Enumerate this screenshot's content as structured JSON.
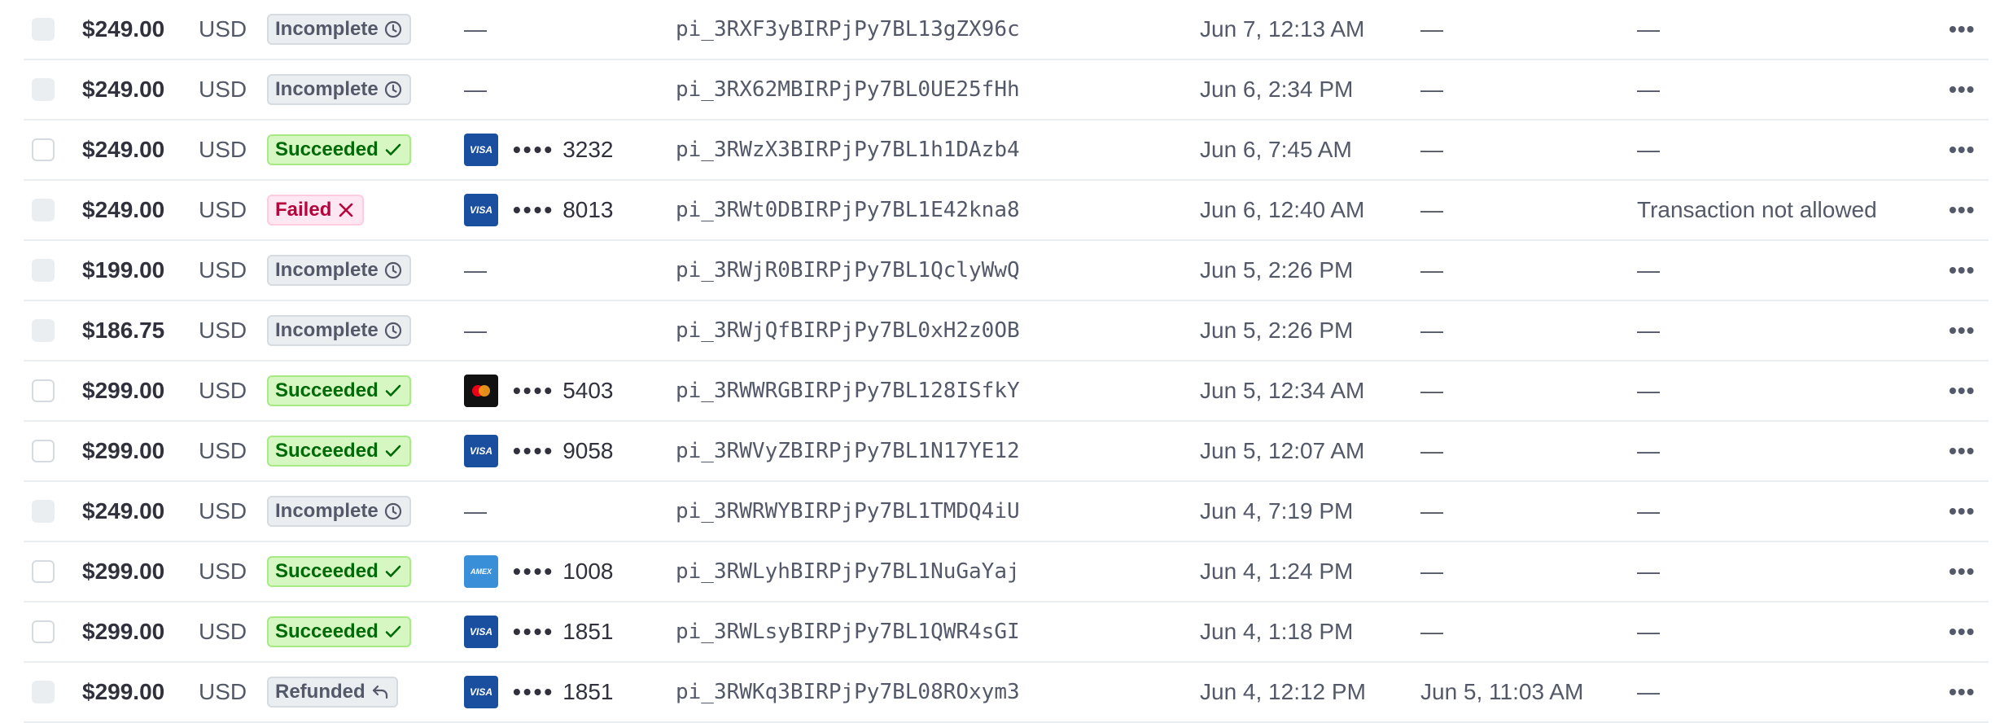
{
  "rows": [
    {
      "amount": "$249.00",
      "currency": "USD",
      "status": "Incomplete",
      "status_kind": "incomplete",
      "card_brand": null,
      "dots": "",
      "last4": "",
      "payment_empty": "—",
      "pi": "pi_3RXF3yBIRPjPy7BL13gZX96c",
      "created": "Jun 7, 12:13 AM",
      "refunded": "—",
      "decline": "—",
      "checkbox_enabled": false
    },
    {
      "amount": "$249.00",
      "currency": "USD",
      "status": "Incomplete",
      "status_kind": "incomplete",
      "card_brand": null,
      "dots": "",
      "last4": "",
      "payment_empty": "—",
      "pi": "pi_3RX62MBIRPjPy7BL0UE25fHh",
      "created": "Jun 6, 2:34 PM",
      "refunded": "—",
      "decline": "—",
      "checkbox_enabled": false
    },
    {
      "amount": "$249.00",
      "currency": "USD",
      "status": "Succeeded",
      "status_kind": "succeeded",
      "card_brand": "visa",
      "dots": "••••",
      "last4": "3232",
      "payment_empty": "",
      "pi": "pi_3RWzX3BIRPjPy7BL1h1DAzb4",
      "created": "Jun 6, 7:45 AM",
      "refunded": "—",
      "decline": "—",
      "checkbox_enabled": true
    },
    {
      "amount": "$249.00",
      "currency": "USD",
      "status": "Failed",
      "status_kind": "failed",
      "card_brand": "visa",
      "dots": "••••",
      "last4": "8013",
      "payment_empty": "",
      "pi": "pi_3RWt0DBIRPjPy7BL1E42kna8",
      "created": "Jun 6, 12:40 AM",
      "refunded": "—",
      "decline": "Transaction not allowed",
      "checkbox_enabled": false
    },
    {
      "amount": "$199.00",
      "currency": "USD",
      "status": "Incomplete",
      "status_kind": "incomplete",
      "card_brand": null,
      "dots": "",
      "last4": "",
      "payment_empty": "—",
      "pi": "pi_3RWjR0BIRPjPy7BL1QclyWwQ",
      "created": "Jun 5, 2:26 PM",
      "refunded": "—",
      "decline": "—",
      "checkbox_enabled": false
    },
    {
      "amount": "$186.75",
      "currency": "USD",
      "status": "Incomplete",
      "status_kind": "incomplete",
      "card_brand": null,
      "dots": "",
      "last4": "",
      "payment_empty": "—",
      "pi": "pi_3RWjQfBIRPjPy7BL0xH2z0OB",
      "created": "Jun 5, 2:26 PM",
      "refunded": "—",
      "decline": "—",
      "checkbox_enabled": false
    },
    {
      "amount": "$299.00",
      "currency": "USD",
      "status": "Succeeded",
      "status_kind": "succeeded",
      "card_brand": "mastercard",
      "dots": "••••",
      "last4": "5403",
      "payment_empty": "",
      "pi": "pi_3RWWRGBIRPjPy7BL128ISfkY",
      "created": "Jun 5, 12:34 AM",
      "refunded": "—",
      "decline": "—",
      "checkbox_enabled": true
    },
    {
      "amount": "$299.00",
      "currency": "USD",
      "status": "Succeeded",
      "status_kind": "succeeded",
      "card_brand": "visa",
      "dots": "••••",
      "last4": "9058",
      "payment_empty": "",
      "pi": "pi_3RWVyZBIRPjPy7BL1N17YE12",
      "created": "Jun 5, 12:07 AM",
      "refunded": "—",
      "decline": "—",
      "checkbox_enabled": true
    },
    {
      "amount": "$249.00",
      "currency": "USD",
      "status": "Incomplete",
      "status_kind": "incomplete",
      "card_brand": null,
      "dots": "",
      "last4": "",
      "payment_empty": "—",
      "pi": "pi_3RWRWYBIRPjPy7BL1TMDQ4iU",
      "created": "Jun 4, 7:19 PM",
      "refunded": "—",
      "decline": "—",
      "checkbox_enabled": false
    },
    {
      "amount": "$299.00",
      "currency": "USD",
      "status": "Succeeded",
      "status_kind": "succeeded",
      "card_brand": "amex",
      "dots": "••••",
      "last4": "1008",
      "payment_empty": "",
      "pi": "pi_3RWLyhBIRPjPy7BL1NuGaYaj",
      "created": "Jun 4, 1:24 PM",
      "refunded": "—",
      "decline": "—",
      "checkbox_enabled": true
    },
    {
      "amount": "$299.00",
      "currency": "USD",
      "status": "Succeeded",
      "status_kind": "succeeded",
      "card_brand": "visa",
      "dots": "••••",
      "last4": "1851",
      "payment_empty": "",
      "pi": "pi_3RWLsyBIRPjPy7BL1QWR4sGI",
      "created": "Jun 4, 1:18 PM",
      "refunded": "—",
      "decline": "—",
      "checkbox_enabled": true
    },
    {
      "amount": "$299.00",
      "currency": "USD",
      "status": "Refunded",
      "status_kind": "refunded",
      "card_brand": "visa",
      "dots": "••••",
      "last4": "1851",
      "payment_empty": "",
      "pi": "pi_3RWKq3BIRPjPy7BL08ROxym3",
      "created": "Jun 4, 12:12 PM",
      "refunded": "Jun 5, 11:03 AM",
      "decline": "—",
      "checkbox_enabled": false
    }
  ],
  "more_label": "•••",
  "card_labels": {
    "visa": "VISA",
    "amex": "AMEX"
  },
  "colors": {
    "succeeded": "#006908",
    "failed": "#b3063d",
    "incomplete": "#545969",
    "border": "#ebeef1",
    "visa": "#1a4f9f",
    "amex": "#3a8fd9"
  }
}
